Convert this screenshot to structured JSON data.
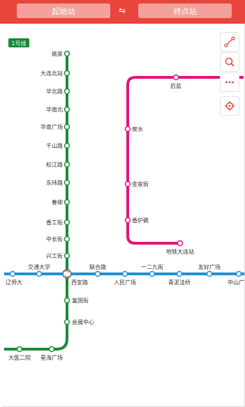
{
  "header": {
    "from_label": "起始站",
    "to_label": "终点站",
    "swap_symbol": "⇋",
    "colors": {
      "bar": "#e8453c",
      "button": "#f4a19b"
    }
  },
  "toolbar": {
    "items": [
      {
        "name": "route-icon"
      },
      {
        "name": "search-icon"
      },
      {
        "name": "more-icon"
      },
      {
        "name": "locate-icon"
      }
    ],
    "accent": "#e8453c"
  },
  "map": {
    "lines": [
      {
        "name": "1号线",
        "color": "#1a8a3a"
      },
      {
        "name": "",
        "color": "#e4137c"
      },
      {
        "name": "",
        "color": "#1e90d6"
      }
    ],
    "line1_badge": "1号线",
    "stations": {
      "line1": [
        "姚家",
        "大连北站",
        "华北路",
        "华南北",
        "华南广场",
        "千山路",
        "松江路",
        "东纬路",
        "春柳",
        "香工街",
        "中长街",
        "兴工街",
        "西安路",
        "富国街",
        "会展中心",
        "星海广场",
        "大医二院"
      ],
      "pink": [
        "后盐",
        "泉水",
        "金家街",
        "香炉礁",
        "地铁大连站"
      ],
      "blue": [
        "辽师大",
        "交通大学",
        "联合路",
        "人民广场",
        "一二九街",
        "青泥洼桥",
        "友好广场",
        "中山广"
      ]
    }
  }
}
